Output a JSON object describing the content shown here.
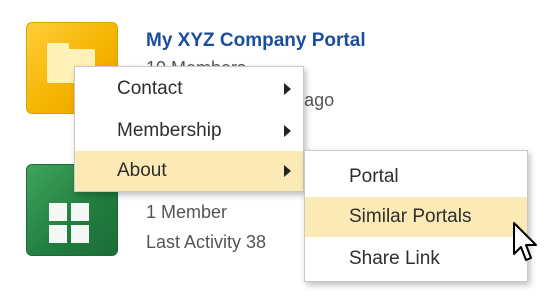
{
  "portals": [
    {
      "title": "My XYZ Company Portal",
      "members": "10 Members",
      "activity": "Last Activity 3 days ago",
      "tile_color": "#f5b400",
      "icon": "folder-icon"
    },
    {
      "members": "1 Member",
      "activity": "Last Activity 38",
      "tile_color": "#217c3f",
      "icon": "grid-icon"
    }
  ],
  "context_menu": {
    "items": [
      {
        "label": "Contact",
        "has_submenu": true
      },
      {
        "label": "Membership",
        "has_submenu": true
      },
      {
        "label": "About",
        "has_submenu": true,
        "active": true
      }
    ]
  },
  "submenu": {
    "items": [
      {
        "label": "Portal"
      },
      {
        "label": "Similar Portals",
        "hovered": true
      },
      {
        "label": "Share Link"
      }
    ]
  },
  "colors": {
    "highlight": "#fbeab5",
    "title_link": "#1b4e9c"
  }
}
